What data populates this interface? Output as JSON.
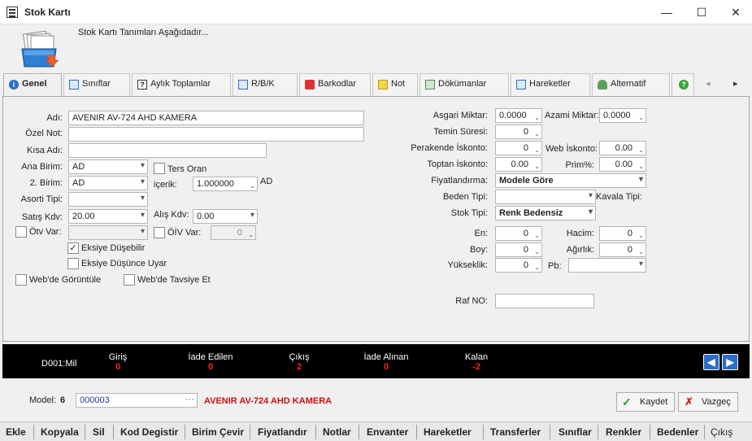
{
  "window": {
    "title": "Stok Kartı",
    "minimize": "—",
    "maximize": "☐",
    "close": "✕"
  },
  "header": {
    "subtitle": "Stok Kartı Tanımları Aşağıdadır..."
  },
  "tabs": [
    "Genel",
    "Sınıflar",
    "Aylık Toplamlar",
    "R/B/K",
    "Barkodlar",
    "Not",
    "Dökümanlar",
    "Hareketler",
    "Alternatif"
  ],
  "tab_nav": {
    "prev": "◂",
    "next": "▸"
  },
  "form": {
    "adi_label": "Adı:",
    "adi_value": "AVENIR AV-724 AHD KAMERA",
    "ozelnot_label": "Özel Not:",
    "ozelnot_value": "",
    "kisaadi_label": "Kısa Adı:",
    "kisaadi_value": "",
    "anabirim_label": "Ana Birim:",
    "anabirim_value": "AD",
    "tersoran_label": "Ters Oran",
    "ikinci_birim_label": "2. Birim:",
    "ikinci_birim_value": "AD",
    "icerik_label": "içerik:",
    "icerik_value": "1.000000",
    "icerik_unit": "AD",
    "asorti_label": "Asorti Tipi:",
    "asorti_value": "",
    "satiskdv_label": "Satış Kdv:",
    "satiskdv_value": "20.00",
    "aliskdv_label": "Alış Kdv:",
    "aliskdv_value": "0.00",
    "otvvar_label": "Ötv Var:",
    "otvvar_value": "",
    "oivvar_label": "ÖİV Var:",
    "oivvar_value": "0",
    "eksiye_dusebilir_label": "Eksiye Düşebilir",
    "eksiye_dusebilir_check": "✓",
    "eksiye_uyar_label": "Eksiye Düşünce Uyar",
    "web_goruntule_label": "Web'de Görüntüle",
    "web_tavsiye_label": "Web'de Tavsiye Et",
    "asgari_label": "Asgari Miktar:",
    "asgari_value": "0.0000",
    "azami_label": "Azami Miktar:",
    "azami_value": "0.0000",
    "temin_label": "Temin Süresi:",
    "temin_value": "0",
    "perakende_label": "Perakende İskonto:",
    "perakende_value": "0",
    "webiskonto_label": "Web İskonto:",
    "webiskonto_value": "0.00",
    "toptan_label": "Toptan İskonto:",
    "toptan_value": "0.00",
    "prim_label": "Prim%:",
    "prim_value": "0.00",
    "fiyat_label": "Fiyatlandırma:",
    "fiyat_value": "Modele Göre",
    "beden_label": "Beden Tipi:",
    "beden_value": "",
    "kavala_label": "Kavala Tipi:",
    "stoktipi_label": "Stok Tipi:",
    "stoktipi_value": "Renk Bedensiz",
    "en_label": "En:",
    "en_value": "0",
    "hacim_label": "Hacim:",
    "hacim_value": "0",
    "boy_label": "Boy:",
    "boy_value": "0",
    "agirlik_label": "Ağırlık:",
    "agirlik_value": "0",
    "yukseklik_label": "Yükseklik:",
    "yukseklik_value": "0",
    "pb_label": "Pb:",
    "pb_value": "",
    "raf_label": "Raf NO:",
    "raf_value": ""
  },
  "infobar": {
    "warehouse": "D001:Mil",
    "giris_label": "Giriş",
    "giris_value": "0",
    "iade_edilen_label": "İade Edilen",
    "iade_edilen_value": "0",
    "cikis_label": "Çıkış",
    "cikis_value": "2",
    "iade_alinan_label": "İade Alınan",
    "iade_alinan_value": "0",
    "kalan_label": "Kalan",
    "kalan_value": "-2",
    "prev": "◀",
    "next": "▶"
  },
  "bottom": {
    "model_label": "Model:",
    "model_number": "6",
    "model_value": "000003",
    "model_dots": "···",
    "product_name": "AVENIR AV-724 AHD KAMERA",
    "save_label": "Kaydet",
    "cancel_label": "Vazgeç"
  },
  "menu": [
    "Ekle",
    "Kopyala",
    "Sil",
    "Kod Degistir",
    "Birim Çevir",
    "Fiyatlandır",
    "Notlar",
    "Envanter",
    "Hareketler",
    "Transferler",
    "Sınıflar",
    "Renkler",
    "Bedenler",
    "Çıkış"
  ],
  "colors": {
    "accent": "#2a6fc9",
    "red_value": "#ff2020",
    "panel": "#f0f0f0"
  }
}
